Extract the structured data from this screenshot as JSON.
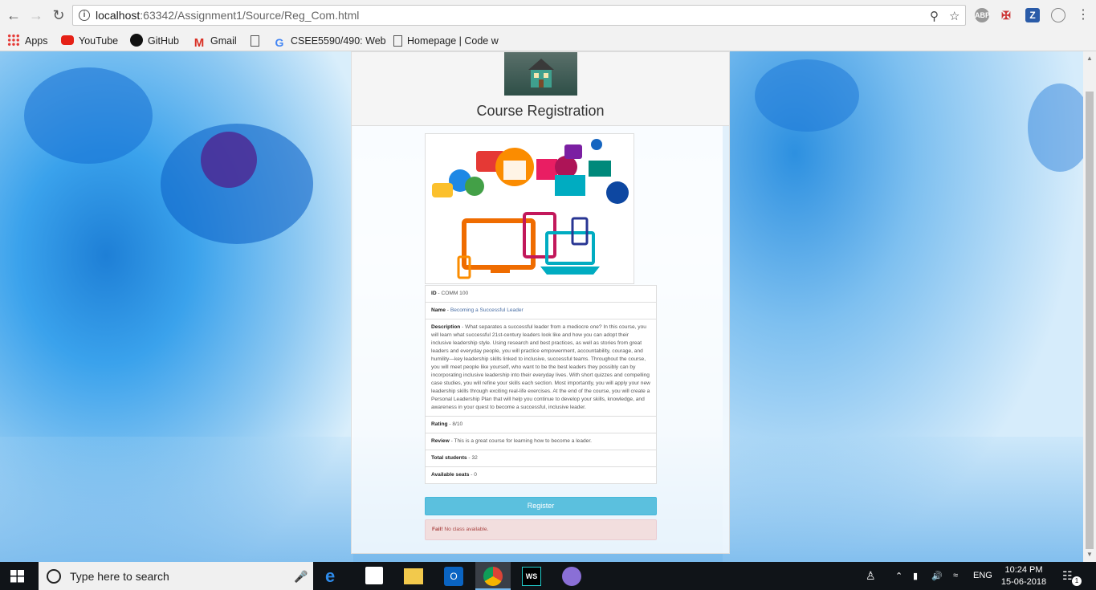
{
  "browser": {
    "url_host": "localhost",
    "url_path": ":63342/Assignment1/Source/Reg_Com.html",
    "bookmarks": [
      {
        "label": "Apps",
        "icon": "apps-grid-icon"
      },
      {
        "label": "YouTube",
        "icon": "youtube-icon"
      },
      {
        "label": "GitHub",
        "icon": "github-icon"
      },
      {
        "label": "Gmail",
        "icon": "gmail-icon"
      },
      {
        "label": "",
        "icon": "page-icon"
      },
      {
        "label": "CSEE5590/490: Web",
        "icon": "google-icon"
      },
      {
        "label": "Homepage | Code w",
        "icon": "page-icon"
      }
    ],
    "extensions": [
      "ABP",
      "Z"
    ]
  },
  "page": {
    "title": "Course Registration",
    "course": {
      "id_label": "ID",
      "id_value": "COMM 100",
      "name_label": "Name",
      "name_value": "Becoming a Successful Leader",
      "description_label": "Description",
      "description_value": "What separates a successful leader from a mediocre one? In this course, you will learn what successful 21st-century leaders look like and how you can adopt their inclusive leadership style. Using research and best practices, as well as stories from great leaders and everyday people, you will practice empowerment, accountability, courage, and humility—key leadership skills linked to inclusive, successful teams. Throughout the course, you will meet people like yourself, who want to be the best leaders they possibly can by incorporating inclusive leadership into their everyday lives. With short quizzes and compelling case studies, you will refine your skills each section. Most importantly, you will apply your new leadership skills through exciting real-life exercises. At the end of the course, you will create a Personal Leadership Plan that will help you continue to develop your skills, knowledge, and awareness in your quest to become a successful, inclusive leader.",
      "rating_label": "Rating",
      "rating_value": "8/10",
      "review_label": "Review",
      "review_value": "This is a great course for learning how to become a leader.",
      "students_label": "Total students",
      "students_value": "32",
      "seats_label": "Available seats",
      "seats_value": "0"
    },
    "register_label": "Register",
    "alert_strong": "Fail!",
    "alert_text": "No class available."
  },
  "taskbar": {
    "search_placeholder": "Type here to search",
    "language": "ENG",
    "time": "10:24 PM",
    "date": "15-06-2018",
    "notification_count": "1"
  },
  "colors": {
    "register_button": "#5bc0de",
    "alert_bg": "#f2dede",
    "alert_text": "#a94442"
  }
}
